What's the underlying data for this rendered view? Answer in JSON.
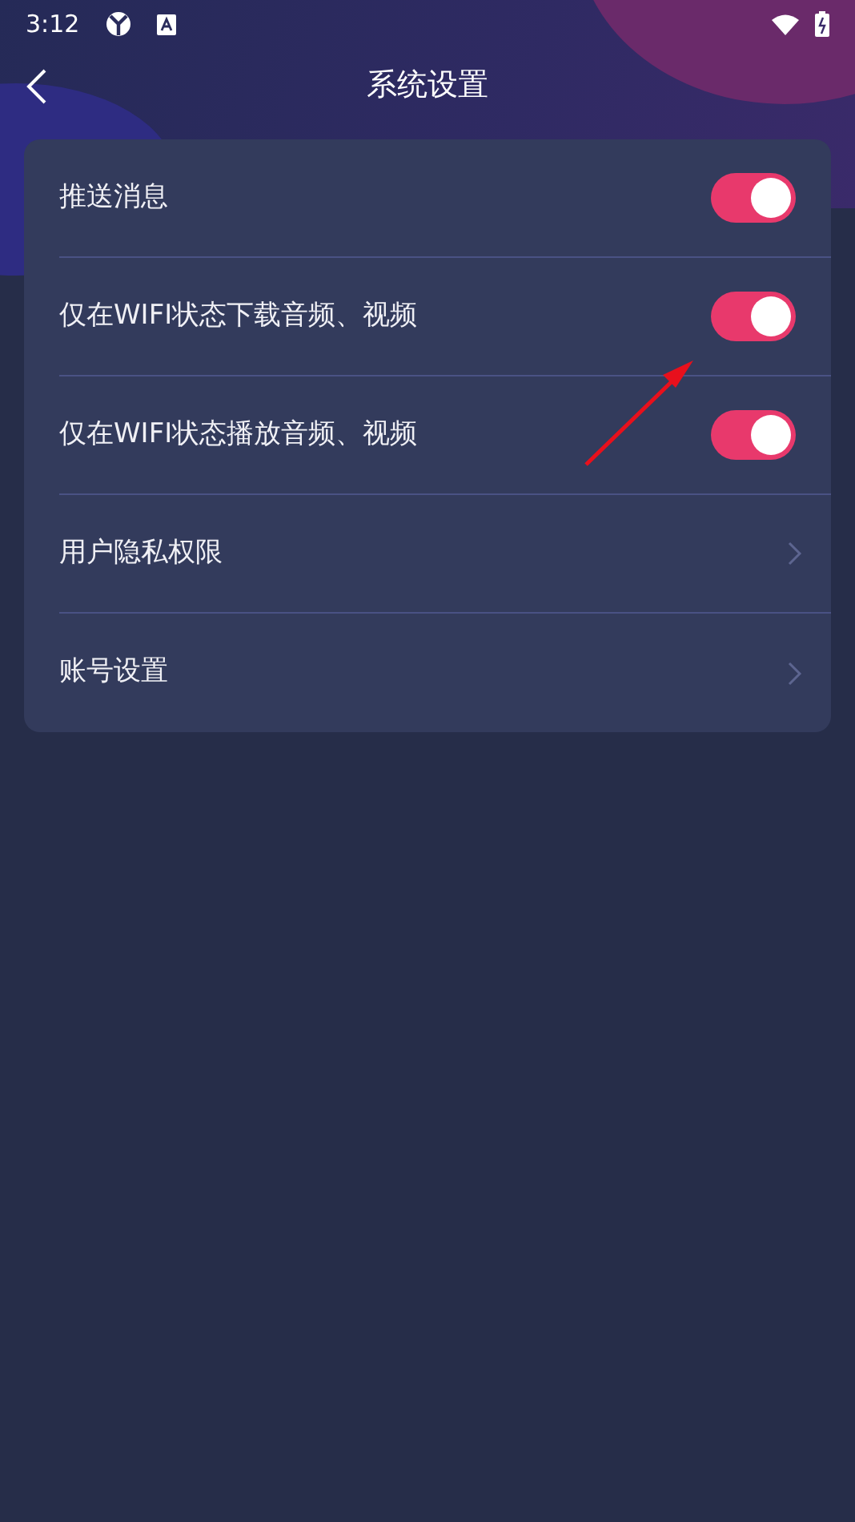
{
  "status_bar": {
    "time": "3:12"
  },
  "header": {
    "title": "系统设置"
  },
  "settings": [
    {
      "kind": "toggle",
      "label": "推送消息",
      "on": true
    },
    {
      "kind": "toggle",
      "label": "仅在WIFI状态下载音频、视频",
      "on": true
    },
    {
      "kind": "toggle",
      "label": "仅在WIFI状态播放音频、视频",
      "on": true
    },
    {
      "kind": "link",
      "label": "用户隐私权限"
    },
    {
      "kind": "link",
      "label": "账号设置"
    }
  ]
}
